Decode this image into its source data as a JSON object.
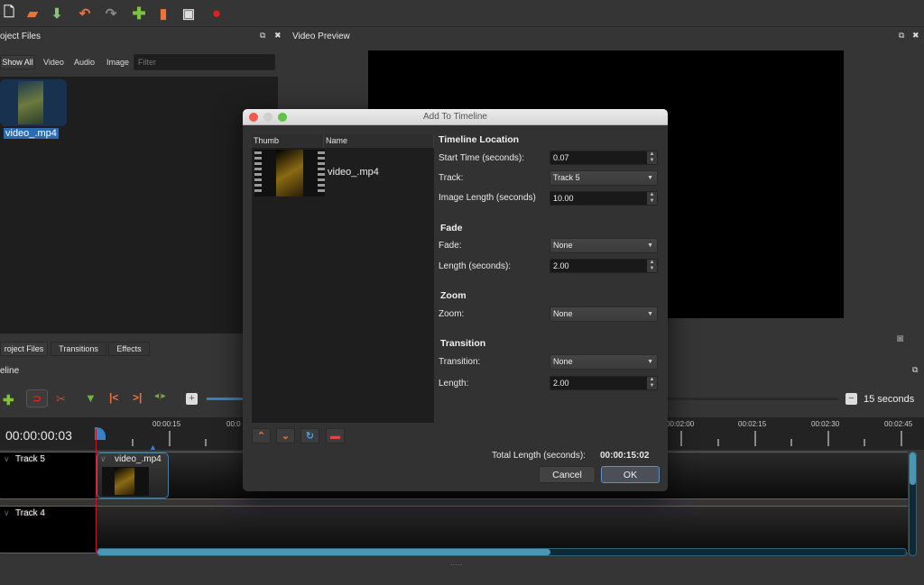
{
  "toolbar": {
    "icons": [
      "new-project-icon",
      "open-project-icon",
      "save-project-icon",
      "undo-icon",
      "redo-icon",
      "import-files-icon",
      "profile-icon",
      "fullscreen-icon",
      "export-video-icon"
    ]
  },
  "project_files": {
    "title": "oject Files",
    "filters": [
      "Show All",
      "Video",
      "Audio",
      "Image"
    ],
    "filter_placeholder": "Filter",
    "files": [
      {
        "name": "video_.mp4"
      }
    ]
  },
  "video_preview": {
    "title": "Video Preview"
  },
  "bottom_tabs": [
    "roject Files",
    "Transitions",
    "Effects"
  ],
  "timeline": {
    "title": "eline",
    "current_time": "00:00:00:03",
    "zoom_label": "15 seconds",
    "ruler_labels": [
      "00:00:15",
      "00:0",
      "00:02:00",
      "00:02:15",
      "00:02:30",
      "00:02:45"
    ],
    "tracks": [
      {
        "name": "Track 5",
        "clips": [
          {
            "name": "video_.mp4"
          }
        ]
      },
      {
        "name": "Track 4",
        "clips": []
      }
    ]
  },
  "dialog": {
    "title": "Add To Timeline",
    "list_columns": [
      "Thumb",
      "Name"
    ],
    "files": [
      {
        "name": "video_.mp4"
      }
    ],
    "timeline_location": {
      "section": "Timeline Location",
      "start_time_label": "Start Time (seconds):",
      "start_time": "0.07",
      "track_label": "Track:",
      "track": "Track 5",
      "image_length_label": "Image Length (seconds)",
      "image_length": "10.00"
    },
    "fade": {
      "section": "Fade",
      "fade_label": "Fade:",
      "fade": "None",
      "length_label": "Length (seconds):",
      "length": "2.00"
    },
    "zoom": {
      "section": "Zoom",
      "zoom_label": "Zoom:",
      "zoom": "None"
    },
    "transition": {
      "section": "Transition",
      "transition_label": "Transition:",
      "transition": "None",
      "length_label": "Length:",
      "length": "2.00"
    },
    "total_length_label": "Total Length (seconds):",
    "total_length": "00:00:15:02",
    "cancel_label": "Cancel",
    "ok_label": "OK"
  }
}
